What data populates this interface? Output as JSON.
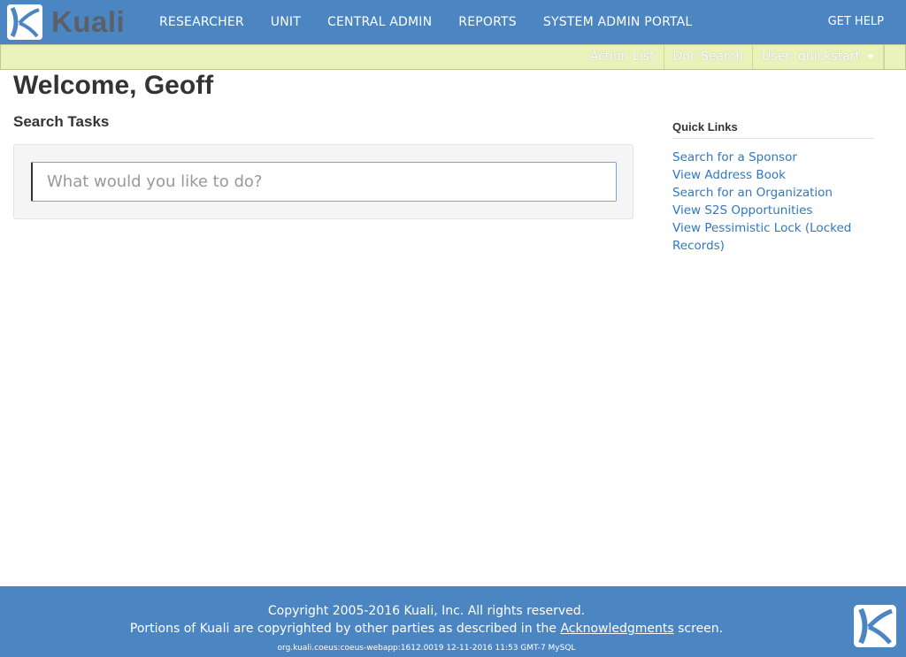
{
  "brand": {
    "name": "Kuali"
  },
  "topnav": {
    "items": [
      {
        "label": "RESEARCHER"
      },
      {
        "label": "UNIT"
      },
      {
        "label": "CENTRAL ADMIN"
      },
      {
        "label": "REPORTS"
      },
      {
        "label": "SYSTEM ADMIN PORTAL"
      }
    ],
    "help_label": "GET HELP"
  },
  "subbar": {
    "action_list": "Action List",
    "doc_search": "Doc Search",
    "user_label": "User: quickstart"
  },
  "main": {
    "welcome": "Welcome, Geoff",
    "search_title": "Search Tasks",
    "search_placeholder": "What would you like to do?"
  },
  "quick_links": {
    "title": "Quick Links",
    "items": [
      {
        "label": "Search for a Sponsor"
      },
      {
        "label": "View Address Book"
      },
      {
        "label": "Search for an Organization"
      },
      {
        "label": "View S2S Opportunities"
      },
      {
        "label": "View Pessimistic Lock (Locked Records)"
      }
    ]
  },
  "footer": {
    "copyright": "Copyright 2005-2016 Kuali, Inc. All rights reserved.",
    "portions_prefix": "Portions of Kuali are copyrighted by other parties as described in the",
    "acknowledgments": "Acknowledgments",
    "portions_suffix": "screen.",
    "version": "org.kuali.coeus:coeus-webapp:1612.0019 12-11-2016 11:53 GMT-7 MySQL"
  },
  "colors": {
    "nav_bg": "#4b86c3",
    "subbar_bg": "#e9f2b8",
    "link": "#2f78c4",
    "logo_text": "#5c6068"
  },
  "icons": {
    "brand_logo": "kuali-logo-icon",
    "user_menu": "caret-down-icon",
    "footer_logo": "kuali-logo-icon"
  }
}
